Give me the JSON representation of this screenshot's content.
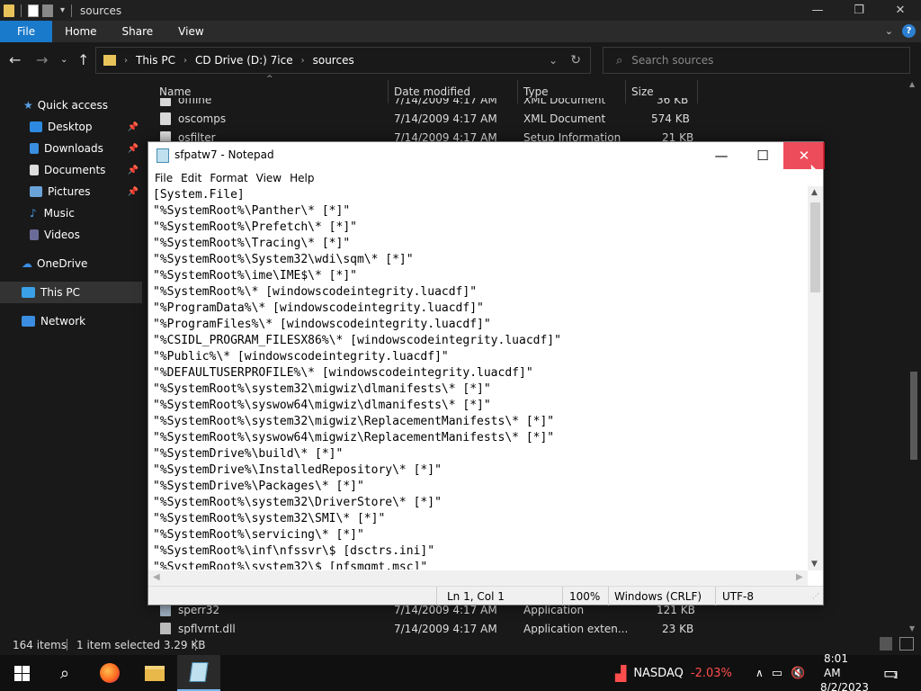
{
  "explorer": {
    "title": "sources",
    "ribbon_tabs": [
      "File",
      "Home",
      "Share",
      "View"
    ],
    "address": {
      "segments": [
        "This PC",
        "CD Drive (D:) 7ice",
        "sources"
      ]
    },
    "search_placeholder": "Search sources",
    "nav": {
      "quick_access": "Quick access",
      "items": [
        {
          "label": "Desktop",
          "icon": "desktop-icon",
          "pinned": true
        },
        {
          "label": "Downloads",
          "icon": "downloads-icon",
          "pinned": true
        },
        {
          "label": "Documents",
          "icon": "documents-icon",
          "pinned": true
        },
        {
          "label": "Pictures",
          "icon": "pictures-icon",
          "pinned": true
        },
        {
          "label": "Music",
          "icon": "music-icon",
          "pinned": false
        },
        {
          "label": "Videos",
          "icon": "videos-icon",
          "pinned": false
        }
      ],
      "onedrive": "OneDrive",
      "this_pc": "This PC",
      "network": "Network"
    },
    "columns": [
      "Name",
      "Date modified",
      "Type",
      "Size"
    ],
    "rows": [
      {
        "name": "offline",
        "date": "7/14/2009 4:17 AM",
        "type": "XML Document",
        "size": "36 KB"
      },
      {
        "name": "oscomps",
        "date": "7/14/2009 4:17 AM",
        "type": "XML Document",
        "size": "574 KB"
      },
      {
        "name": "osfilter",
        "date": "7/14/2009 4:17 AM",
        "type": "Setup Information",
        "size": "21 KB"
      },
      {
        "name": "sperr32",
        "date": "7/14/2009 4:17 AM",
        "type": "Application",
        "size": "121 KB"
      },
      {
        "name": "spflvrnt.dll",
        "date": "7/14/2009 4:17 AM",
        "type": "Application exten...",
        "size": "23 KB"
      }
    ],
    "status": {
      "count": "164 items",
      "selected": "1 item selected  3.29 KB"
    }
  },
  "notepad": {
    "title": "sfpatw7 - Notepad",
    "menu": [
      "File",
      "Edit",
      "Format",
      "View",
      "Help"
    ],
    "lines": [
      "[System.File]",
      "\"%SystemRoot%\\Panther\\* [*]\"",
      "\"%SystemRoot%\\Prefetch\\* [*]\"",
      "\"%SystemRoot%\\Tracing\\* [*]\"",
      "\"%SystemRoot%\\System32\\wdi\\sqm\\* [*]\"",
      "\"%SystemRoot%\\ime\\IME$\\* [*]\"",
      "\"%SystemRoot%\\* [windowscodeintegrity.luacdf]\"",
      "\"%ProgramData%\\* [windowscodeintegrity.luacdf]\"",
      "\"%ProgramFiles%\\* [windowscodeintegrity.luacdf]\"",
      "\"%CSIDL_PROGRAM_FILESX86%\\* [windowscodeintegrity.luacdf]\"",
      "\"%Public%\\* [windowscodeintegrity.luacdf]\"",
      "\"%DEFAULTUSERPROFILE%\\* [windowscodeintegrity.luacdf]\"",
      "\"%SystemRoot%\\system32\\migwiz\\dlmanifests\\* [*]\"",
      "\"%SystemRoot%\\syswow64\\migwiz\\dlmanifests\\* [*]\"",
      "\"%SystemRoot%\\system32\\migwiz\\ReplacementManifests\\* [*]\"",
      "\"%SystemRoot%\\syswow64\\migwiz\\ReplacementManifests\\* [*]\"",
      "\"%SystemDrive%\\build\\* [*]\"",
      "\"%SystemDrive%\\InstalledRepository\\* [*]\"",
      "\"%SystemDrive%\\Packages\\* [*]\"",
      "\"%SystemRoot%\\system32\\DriverStore\\* [*]\"",
      "\"%SystemRoot%\\system32\\SMI\\* [*]\"",
      "\"%SystemRoot%\\servicing\\* [*]\"",
      "\"%SystemRoot%\\inf\\nfssvr\\$ [dsctrs.ini]\"",
      "\"%SystemRoot%\\system32\\$ [nfsmgmt.msc]\""
    ],
    "status": {
      "position": "Ln 1, Col 1",
      "zoom": "100%",
      "eol": "Windows (CRLF)",
      "encoding": "UTF-8"
    }
  },
  "taskbar": {
    "stock_name": "NASDAQ",
    "stock_change": "-2.03%",
    "time": "8:01 AM",
    "date": "8/2/2023",
    "notif_count": "1"
  },
  "colors": {
    "accent": "#1979ca",
    "close_red": "#e81123",
    "stock_red": "#ff4d4d"
  }
}
